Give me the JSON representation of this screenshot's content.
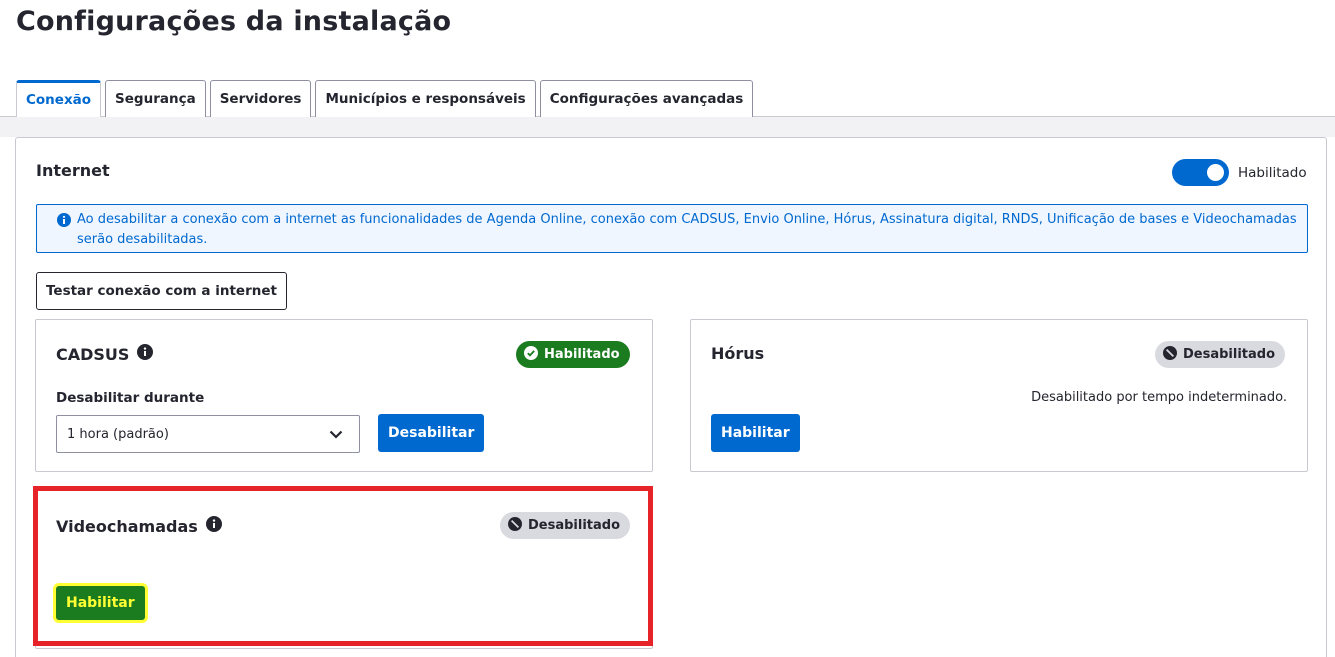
{
  "page": {
    "title": "Configurações da instalação"
  },
  "tabs": [
    {
      "label": "Conexão",
      "active": true
    },
    {
      "label": "Segurança",
      "active": false
    },
    {
      "label": "Servidores",
      "active": false
    },
    {
      "label": "Municípios e responsáveis",
      "active": false
    },
    {
      "label": "Configurações avançadas",
      "active": false
    }
  ],
  "internet": {
    "title": "Internet",
    "toggle_label": "Habilitado",
    "toggle_on": true,
    "alert": "Ao desabilitar a conexão com a internet as funcionalidades de Agenda Online, conexão com CADSUS, Envio Online, Hórus, Assinatura digital, RNDS, Unificação de bases e Videochamadas serão desabilitadas.",
    "test_button": "Testar conexão com a internet"
  },
  "cadsus": {
    "title": "CADSUS",
    "status": "Habilitado",
    "field_label": "Desabilitar durante",
    "select_value": "1 hora (padrão)",
    "button": "Desabilitar"
  },
  "horus": {
    "title": "Hórus",
    "status": "Desabilitado",
    "helper": "Desabilitado por tempo indeterminado.",
    "button": "Habilitar"
  },
  "videochamadas": {
    "title": "Videochamadas",
    "status": "Desabilitado",
    "button": "Habilitar"
  },
  "colors": {
    "primary": "#0069d0",
    "success": "#1b7c1f",
    "neutral_badge": "#d9d9e0",
    "highlight_border": "#e52329",
    "highlight_text": "#ffff33"
  }
}
